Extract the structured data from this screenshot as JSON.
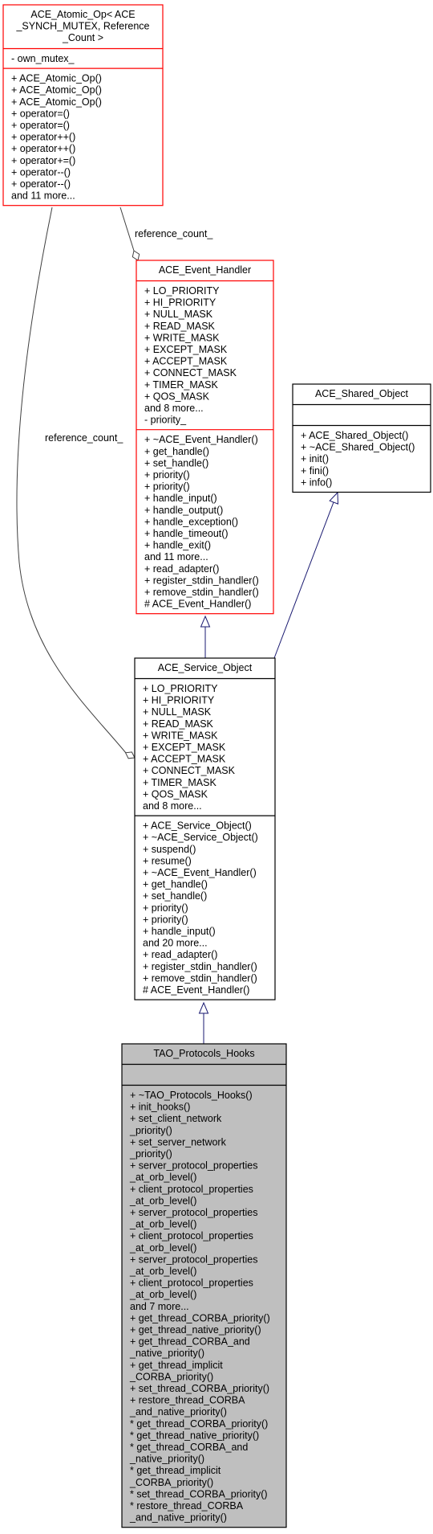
{
  "colors": {
    "incomplete_border": "#ff0000",
    "normal_border": "#000000",
    "focus_fill": "#bfbfbf",
    "inheritance_edge": "#191970",
    "usage_edge": "#404040"
  },
  "classes": [
    {
      "id": "ace-atomic-op",
      "title": [
        "ACE_Atomic_Op< ACE",
        "_SYNCH_MUTEX, Reference",
        "_Count >"
      ],
      "border": "incomplete",
      "sections": [
        [
          "- own_mutex_"
        ],
        [
          "+ ACE_Atomic_Op()",
          "+ ACE_Atomic_Op()",
          "+ ACE_Atomic_Op()",
          "+ operator=()",
          "+ operator=()",
          "+ operator++()",
          "+ operator++()",
          "+ operator+=()",
          "+ operator--()",
          "+ operator--()",
          "and 11 more..."
        ]
      ]
    },
    {
      "id": "ace-event-handler",
      "title": [
        "ACE_Event_Handler"
      ],
      "border": "incomplete",
      "sections": [
        [
          "+ LO_PRIORITY",
          "+ HI_PRIORITY",
          "+ NULL_MASK",
          "+ READ_MASK",
          "+ WRITE_MASK",
          "+ EXCEPT_MASK",
          "+ ACCEPT_MASK",
          "+ CONNECT_MASK",
          "+ TIMER_MASK",
          "+ QOS_MASK",
          "and 8 more...",
          "- priority_"
        ],
        [
          "+ ~ACE_Event_Handler()",
          "+ get_handle()",
          "+ set_handle()",
          "+ priority()",
          "+ priority()",
          "+ handle_input()",
          "+ handle_output()",
          "+ handle_exception()",
          "+ handle_timeout()",
          "+ handle_exit()",
          "and 11 more...",
          "+ read_adapter()",
          "+ register_stdin_handler()",
          "+ remove_stdin_handler()",
          "# ACE_Event_Handler()"
        ]
      ]
    },
    {
      "id": "ace-shared-object",
      "title": [
        "ACE_Shared_Object"
      ],
      "border": "normal",
      "sections": [
        [],
        [
          "+ ACE_Shared_Object()",
          "+ ~ACE_Shared_Object()",
          "+ init()",
          "+ fini()",
          "+ info()"
        ]
      ]
    },
    {
      "id": "ace-service-object",
      "title": [
        "ACE_Service_Object"
      ],
      "border": "normal",
      "sections": [
        [
          "+ LO_PRIORITY",
          "+ HI_PRIORITY",
          "+ NULL_MASK",
          "+ READ_MASK",
          "+ WRITE_MASK",
          "+ EXCEPT_MASK",
          "+ ACCEPT_MASK",
          "+ CONNECT_MASK",
          "+ TIMER_MASK",
          "+ QOS_MASK",
          "and 8 more..."
        ],
        [
          "+ ACE_Service_Object()",
          "+ ~ACE_Service_Object()",
          "+ suspend()",
          "+ resume()",
          "+ ~ACE_Event_Handler()",
          "+ get_handle()",
          "+ set_handle()",
          "+ priority()",
          "+ priority()",
          "+ handle_input()",
          "and 20 more...",
          "+ read_adapter()",
          "+ register_stdin_handler()",
          "+ remove_stdin_handler()",
          "# ACE_Event_Handler()"
        ]
      ]
    },
    {
      "id": "tao-protocols-hooks",
      "title": [
        "TAO_Protocols_Hooks"
      ],
      "border": "normal",
      "focus": true,
      "sections": [
        [],
        [
          "+ ~TAO_Protocols_Hooks()",
          "+ init_hooks()",
          "+ set_client_network",
          "_priority()",
          "+ set_server_network",
          "_priority()",
          "+ server_protocol_properties",
          "_at_orb_level()",
          "+ client_protocol_properties",
          "_at_orb_level()",
          "+ server_protocol_properties",
          "_at_orb_level()",
          "+ client_protocol_properties",
          "_at_orb_level()",
          "+ server_protocol_properties",
          "_at_orb_level()",
          "+ client_protocol_properties",
          "_at_orb_level()",
          "and 7 more...",
          "+ get_thread_CORBA_priority()",
          "+ get_thread_native_priority()",
          "+ get_thread_CORBA_and",
          "_native_priority()",
          "+ get_thread_implicit",
          "_CORBA_priority()",
          "+ set_thread_CORBA_priority()",
          "+ restore_thread_CORBA",
          "_and_native_priority()",
          "* get_thread_CORBA_priority()",
          "* get_thread_native_priority()",
          "* get_thread_CORBA_and",
          "_native_priority()",
          "* get_thread_implicit",
          "_CORBA_priority()",
          "* set_thread_CORBA_priority()",
          "* restore_thread_CORBA",
          "_and_native_priority()"
        ]
      ]
    }
  ],
  "edges": [
    {
      "id": "atomic-to-event-handler",
      "kind": "usage",
      "from": "ace-atomic-op",
      "to": "ace-event-handler",
      "label": "reference_count_"
    },
    {
      "id": "atomic-to-service-object",
      "kind": "usage",
      "from": "ace-atomic-op",
      "to": "ace-service-object",
      "label": "reference_count_"
    },
    {
      "id": "event-handler-to-service-object",
      "kind": "inheritance",
      "from": "ace-event-handler",
      "to": "ace-service-object"
    },
    {
      "id": "shared-object-to-service-object",
      "kind": "inheritance",
      "from": "ace-shared-object",
      "to": "ace-service-object"
    },
    {
      "id": "service-object-to-tao-hooks",
      "kind": "inheritance",
      "from": "ace-service-object",
      "to": "tao-protocols-hooks"
    }
  ]
}
